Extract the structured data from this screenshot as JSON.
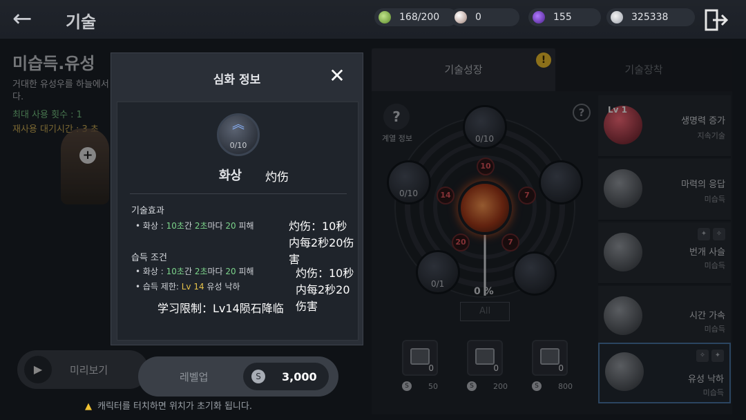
{
  "header": {
    "title": "기술",
    "resources": {
      "stamina": "168/200",
      "pearl": "0",
      "gem": "155",
      "silver": "325338"
    }
  },
  "skill": {
    "name": "미습득.유성",
    "desc": "거대한 유성우를 하늘에서 지면으로 내려 꽂는다.",
    "uses": "최대 사용 횟수 : 1",
    "cooldown": "재사용 대기시간 : 3 초"
  },
  "actions": {
    "preview": "미리보기",
    "levelup": "레벨업",
    "levelup_cost": "3,000",
    "warning": "캐릭터를 터치하면 위치가 초기화 됩니다."
  },
  "tabs": {
    "growth": "기술성장",
    "equip": "기술장착",
    "alert": "!"
  },
  "tree": {
    "help_label": "계열 정보",
    "nodes": {
      "top": "0/10",
      "left": "0/10",
      "bottom_left": "0/1"
    },
    "requirements": [
      "10",
      "14",
      "7",
      "20",
      "7"
    ],
    "progress": "0 %",
    "filter": "All",
    "books": [
      {
        "count": "0",
        "cost": "50"
      },
      {
        "count": "0",
        "cost": "200"
      },
      {
        "count": "0",
        "cost": "800"
      }
    ]
  },
  "skill_list": [
    {
      "name": "생명력 증가",
      "sub": "지속기술",
      "level": "Lv 1"
    },
    {
      "name": "마력의 응답",
      "sub": "미습득"
    },
    {
      "name": "번개 사슬",
      "sub": "미습득"
    },
    {
      "name": "시간 가속",
      "sub": "미습득"
    },
    {
      "name": "유성 낙하",
      "sub": "미습득"
    }
  ],
  "modal": {
    "title": "심화 정보",
    "close": "✕",
    "perk_count": "0/10",
    "perk_name": "화상",
    "perk_name_tr": "灼伤",
    "effect_header": "기술효과",
    "effect_line": {
      "a": "• 화상 : ",
      "b": "10초",
      "c": "간 ",
      "d": "2초",
      "e": "마다 ",
      "f": "20",
      "g": " 피해"
    },
    "effect_tr": "灼伤：10秒内每2秒20伤害",
    "cond_header": "습득 조건",
    "cond_line1": {
      "a": "• 화상 : ",
      "b": "10초",
      "c": "간 ",
      "d": "2초",
      "e": "마다 ",
      "f": "20",
      "g": " 피해"
    },
    "cond_tr1": "灼伤：10秒内每2秒20伤害",
    "cond_line2": {
      "a": "• 습득 제한: ",
      "b": "Lv 14",
      "c": " 유성 낙하"
    },
    "cond_tr2": "学习限制：Lv14陨石降临"
  }
}
